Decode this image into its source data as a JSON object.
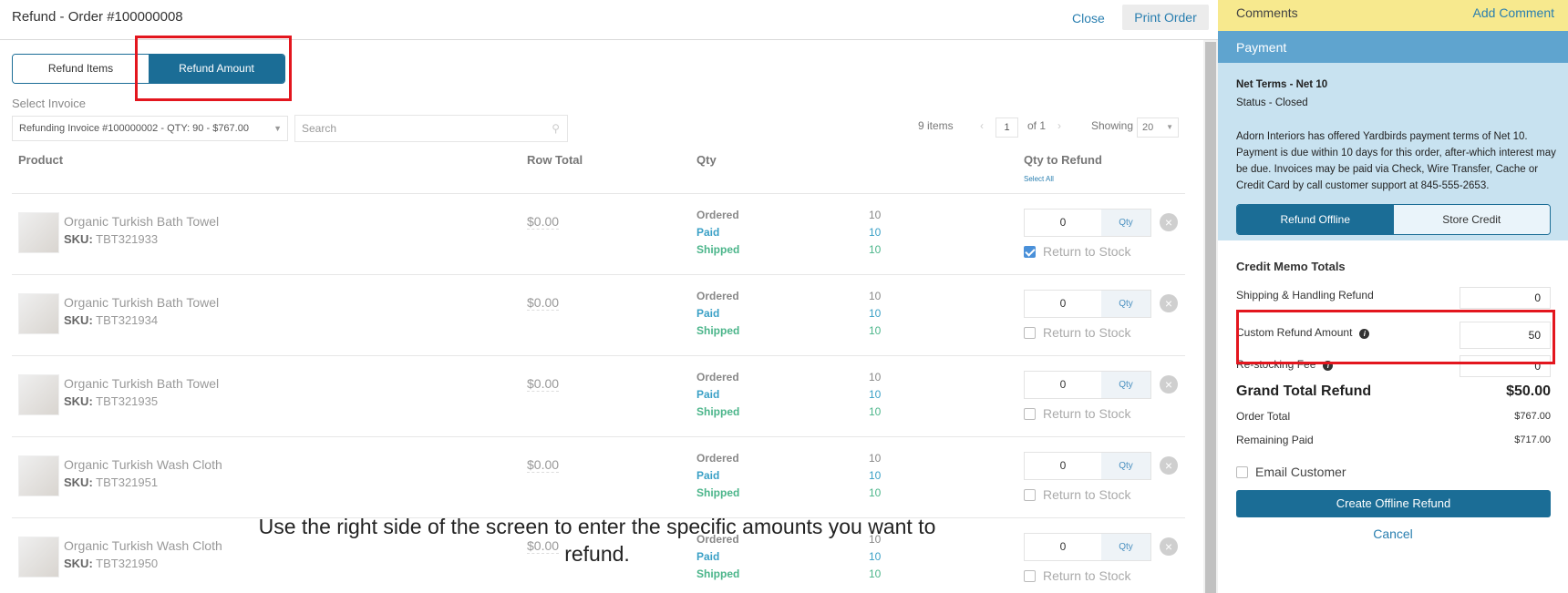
{
  "header": {
    "title": "Refund - Order #100000008",
    "close_label": "Close",
    "print_label": "Print Order"
  },
  "tabs": {
    "refund_items": "Refund Items",
    "refund_amount": "Refund Amount"
  },
  "invoice": {
    "select_label": "Select Invoice",
    "selected": "Refunding Invoice #100000002 - QTY: 90 - $767.00",
    "search_placeholder": "Search"
  },
  "pager": {
    "items": "9 items",
    "page": "1",
    "of": "of 1",
    "showing_label": "Showing",
    "showing_value": "20"
  },
  "columns": {
    "product": "Product",
    "row_total": "Row Total",
    "qty": "Qty",
    "qty_to_refund": "Qty to Refund",
    "select_all": "Select All"
  },
  "qty_labels": {
    "ordered": "Ordered",
    "paid": "Paid",
    "shipped": "Shipped",
    "qty_suffix": "Qty",
    "return_to_stock": "Return to Stock",
    "sku_label": "SKU:"
  },
  "rows": [
    {
      "name": "Organic Turkish Bath Towel",
      "sku": "TBT321933",
      "row_total": "$0.00",
      "ordered": "10",
      "paid": "10",
      "shipped": "10",
      "refund_qty": "0",
      "return_checked": true
    },
    {
      "name": "Organic Turkish Bath Towel",
      "sku": "TBT321934",
      "row_total": "$0.00",
      "ordered": "10",
      "paid": "10",
      "shipped": "10",
      "refund_qty": "0",
      "return_checked": false
    },
    {
      "name": "Organic Turkish Bath Towel",
      "sku": "TBT321935",
      "row_total": "$0.00",
      "ordered": "10",
      "paid": "10",
      "shipped": "10",
      "refund_qty": "0",
      "return_checked": false
    },
    {
      "name": "Organic Turkish Wash Cloth",
      "sku": "TBT321951",
      "row_total": "$0.00",
      "ordered": "10",
      "paid": "10",
      "shipped": "10",
      "refund_qty": "0",
      "return_checked": false
    },
    {
      "name": "Organic Turkish Wash Cloth",
      "sku": "TBT321950",
      "row_total": "$0.00",
      "ordered": "10",
      "paid": "10",
      "shipped": "10",
      "refund_qty": "0",
      "return_checked": false
    }
  ],
  "caption": "Use the right side of the screen to enter the specific amounts you want to refund.",
  "sidebar": {
    "comments_label": "Comments",
    "add_comment": "Add Comment",
    "payment_label": "Payment",
    "net_terms": "Net Terms - Net 10",
    "status": "Status - Closed",
    "description": "Adorn Interiors has offered Yardbirds payment terms of Net 10. Payment is due within 10 days for this order, after-which interest may be due. Invoices may be paid via Check, Wire Transfer, Cache or Credit Card by call customer support at 845-555-2653.",
    "refund_offline": "Refund Offline",
    "store_credit": "Store Credit",
    "credit_memo_title": "Credit Memo Totals",
    "shipping_label": "Shipping & Handling Refund",
    "shipping_value": "0",
    "custom_label": "Custom Refund Amount",
    "custom_value": "50",
    "restocking_label": "Re-stocking Fee",
    "restocking_value": "0",
    "grand_total_label": "Grand Total Refund",
    "grand_total_value": "$50.00",
    "order_total_label": "Order Total",
    "order_total_value": "$767.00",
    "remaining_label": "Remaining Paid",
    "remaining_value": "$717.00",
    "email_customer": "Email Customer",
    "create_button": "Create Offline Refund",
    "cancel": "Cancel"
  },
  "colors": {
    "primary": "#1b6d96",
    "highlight": "#e3161e",
    "comments_bg": "#f7e98e",
    "payment_bg": "#c8e2f0"
  }
}
